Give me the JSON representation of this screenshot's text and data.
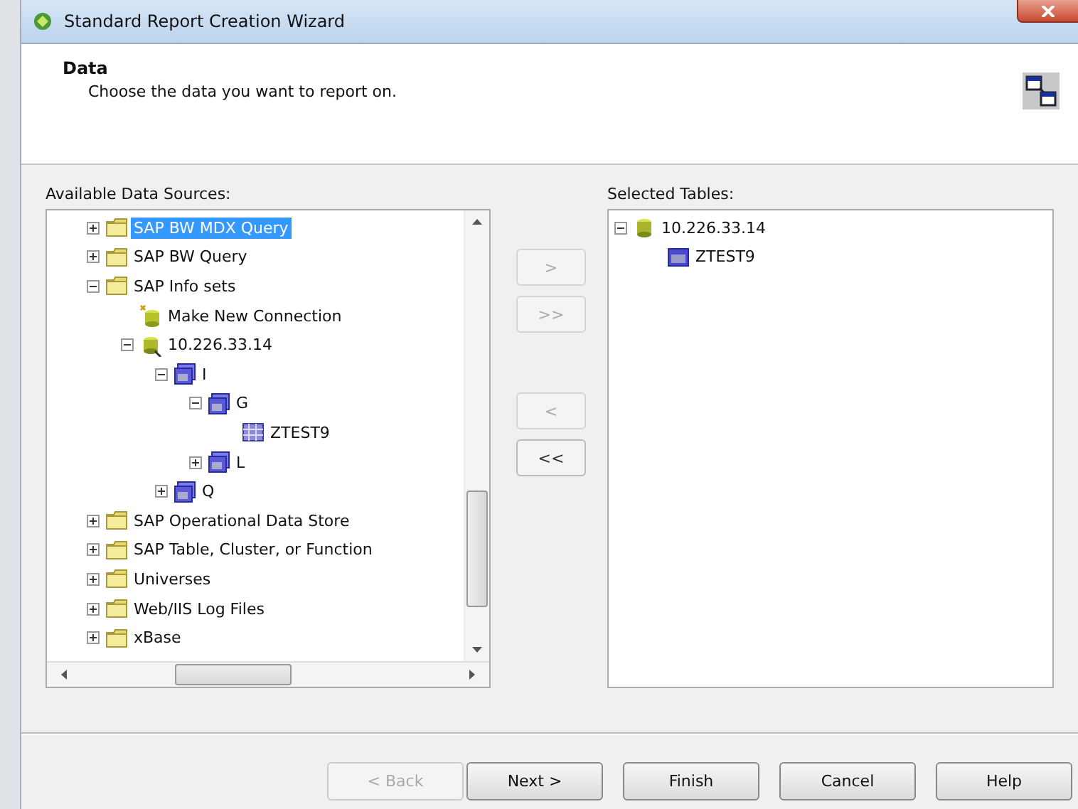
{
  "window": {
    "title": "Standard Report Creation Wizard"
  },
  "header": {
    "title": "Data",
    "subtitle": "Choose the data you want to report on."
  },
  "available": {
    "label": "Available Data Sources:",
    "items": [
      {
        "label": "SAP BW MDX Query",
        "kind": "folder",
        "expanded": false,
        "selected": true
      },
      {
        "label": "SAP BW Query",
        "kind": "folder",
        "expanded": false,
        "selected": false
      },
      {
        "label": "SAP Info sets",
        "kind": "folder",
        "expanded": true,
        "selected": false,
        "children": [
          {
            "label": "Make New Connection",
            "kind": "new-connection",
            "selected": false
          },
          {
            "label": "10.226.33.14",
            "kind": "server",
            "expanded": true,
            "selected": false,
            "children": [
              {
                "label": "I",
                "kind": "infoset",
                "expanded": true,
                "selected": false,
                "children": [
                  {
                    "label": "G",
                    "kind": "infoset",
                    "expanded": true,
                    "selected": false,
                    "children": [
                      {
                        "label": "ZTEST9",
                        "kind": "table",
                        "selected": false
                      }
                    ]
                  },
                  {
                    "label": "L",
                    "kind": "infoset",
                    "expanded": false,
                    "selected": false
                  }
                ]
              },
              {
                "label": "Q",
                "kind": "infoset",
                "expanded": false,
                "selected": false
              }
            ]
          }
        ]
      },
      {
        "label": "SAP Operational Data Store",
        "kind": "folder",
        "expanded": false,
        "selected": false
      },
      {
        "label": "SAP Table, Cluster, or Function",
        "kind": "folder",
        "expanded": false,
        "selected": false
      },
      {
        "label": "Universes",
        "kind": "folder",
        "expanded": false,
        "selected": false
      },
      {
        "label": "Web/IIS Log Files",
        "kind": "folder",
        "expanded": false,
        "selected": false
      },
      {
        "label": "xBase",
        "kind": "folder",
        "expanded": false,
        "selected": false
      }
    ]
  },
  "move_buttons": [
    {
      "label": ">",
      "disabled": true
    },
    {
      "label": ">>",
      "disabled": true
    },
    {
      "label": "<",
      "disabled": true
    },
    {
      "label": "<<",
      "disabled": false
    }
  ],
  "selected_tables": {
    "label": "Selected Tables:",
    "items": [
      {
        "label": "10.226.33.14",
        "kind": "server-db",
        "expanded": true,
        "selected": false,
        "children": [
          {
            "label": "ZTEST9",
            "kind": "table-small",
            "selected": false
          }
        ]
      }
    ]
  },
  "buttons": [
    {
      "label": "< Back",
      "disabled": true
    },
    {
      "label": "Next >",
      "disabled": false
    },
    {
      "label": "Finish",
      "disabled": false
    },
    {
      "label": "Cancel",
      "disabled": false
    },
    {
      "label": "Help",
      "disabled": false
    }
  ]
}
